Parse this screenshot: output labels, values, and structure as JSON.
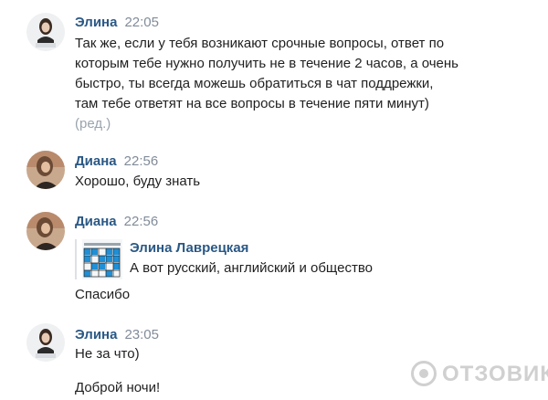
{
  "messages": [
    {
      "author": "Элина",
      "time": "22:05",
      "lines": [
        "Так же, если у тебя возникают срочные вопросы, ответ по",
        "которым тебе нужно получить не в течение 2 часов, а очень",
        "быстро, ты всегда можешь обратиться в чат поддрежки,",
        "там тебе ответят на все вопросы в течение пяти минут)"
      ],
      "edited": "(ред.)"
    },
    {
      "author": "Диана",
      "time": "22:56",
      "text": "Хорошо, буду знать"
    },
    {
      "author": "Диана",
      "time": "22:56",
      "forward": {
        "author": "Элина Лаврецкая",
        "text": "А вот русский, английский и общество"
      },
      "text": "Спасибо"
    },
    {
      "author": "Элина",
      "time": "23:05",
      "text": "Не за что)",
      "text2": "Доброй ночи!"
    }
  ],
  "watermark": "ОТЗОВИК"
}
